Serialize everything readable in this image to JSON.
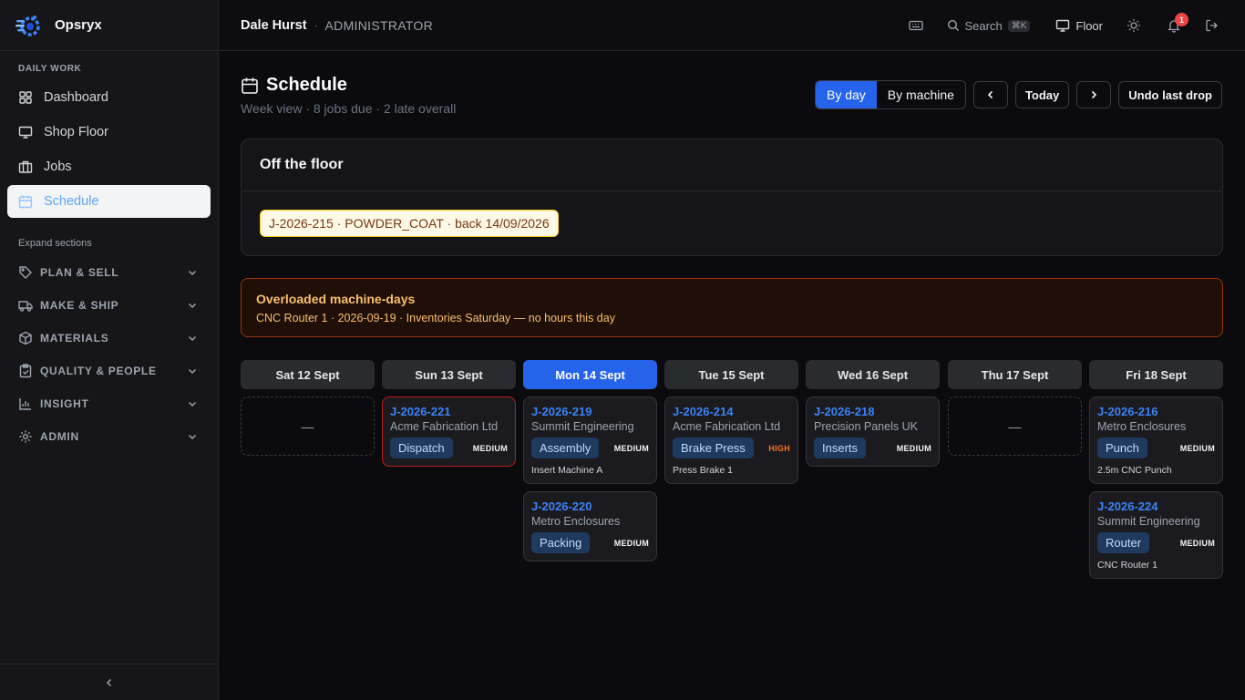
{
  "app": {
    "name": "Opsryx"
  },
  "sidebar": {
    "section_label": "DAILY WORK",
    "items": [
      {
        "label": "Dashboard",
        "icon": "grid-icon"
      },
      {
        "label": "Shop Floor",
        "icon": "monitor-icon"
      },
      {
        "label": "Jobs",
        "icon": "briefcase-icon"
      },
      {
        "label": "Schedule",
        "icon": "calendar-icon",
        "active": true
      }
    ],
    "expand_label": "Expand sections",
    "groups": [
      {
        "label": "PLAN & SELL",
        "icon": "tag-icon"
      },
      {
        "label": "MAKE & SHIP",
        "icon": "truck-icon"
      },
      {
        "label": "MATERIALS",
        "icon": "box-icon"
      },
      {
        "label": "QUALITY & PEOPLE",
        "icon": "clipboard-icon"
      },
      {
        "label": "INSIGHT",
        "icon": "bar-chart-icon"
      },
      {
        "label": "ADMIN",
        "icon": "gear-icon"
      }
    ]
  },
  "topbar": {
    "user_name": "Dale Hurst",
    "separator": "·",
    "user_role": "ADMINISTRATOR",
    "search_label": "Search",
    "search_shortcut": "⌘K",
    "floor_label": "Floor",
    "notification_count": "1"
  },
  "page": {
    "title": "Schedule",
    "subtitle": "Week view · 8 jobs due · 2 late overall",
    "view_by_day": "By day",
    "view_by_machine": "By machine",
    "today_label": "Today",
    "undo_label": "Undo last drop"
  },
  "off_floor": {
    "title": "Off the floor",
    "chip": "J-2026-215 · POWDER_COAT · back 14/09/2026"
  },
  "overload": {
    "title": "Overloaded machine-days",
    "line": "CNC Router 1 · 2026-09-19 · Inventories Saturday — no hours this day"
  },
  "days": [
    {
      "label": "Sat 12 Sept",
      "empty": "—"
    },
    {
      "label": "Sun 13 Sept"
    },
    {
      "label": "Mon 14 Sept",
      "today": true
    },
    {
      "label": "Tue 15 Sept"
    },
    {
      "label": "Wed 16 Sept"
    },
    {
      "label": "Thu 17 Sept",
      "empty": "—"
    },
    {
      "label": "Fri 18 Sept"
    }
  ],
  "jobs": {
    "j221": {
      "id": "J-2026-221",
      "customer": "Acme Fabrication Ltd",
      "stage": "Dispatch",
      "priority": "MEDIUM",
      "late": true
    },
    "j219": {
      "id": "J-2026-219",
      "customer": "Summit Engineering",
      "stage": "Assembly",
      "priority": "MEDIUM",
      "machine": "Insert Machine A"
    },
    "j220": {
      "id": "J-2026-220",
      "customer": "Metro Enclosures",
      "stage": "Packing",
      "priority": "MEDIUM"
    },
    "j214": {
      "id": "J-2026-214",
      "customer": "Acme Fabrication Ltd",
      "stage": "Brake Press",
      "priority": "HIGH",
      "machine": "Press Brake 1"
    },
    "j218": {
      "id": "J-2026-218",
      "customer": "Precision Panels UK",
      "stage": "Inserts",
      "priority": "MEDIUM"
    },
    "j216": {
      "id": "J-2026-216",
      "customer": "Metro Enclosures",
      "stage": "Punch",
      "priority": "MEDIUM",
      "machine": "2.5m CNC Punch"
    },
    "j224": {
      "id": "J-2026-224",
      "customer": "Summit Engineering",
      "stage": "Router",
      "priority": "MEDIUM",
      "machine": "CNC Router 1"
    }
  },
  "colors": {
    "accent": "#2563eb",
    "late_border": "#b91c1c",
    "high_priority": "#f97316",
    "warning": "#fbbf6f"
  }
}
